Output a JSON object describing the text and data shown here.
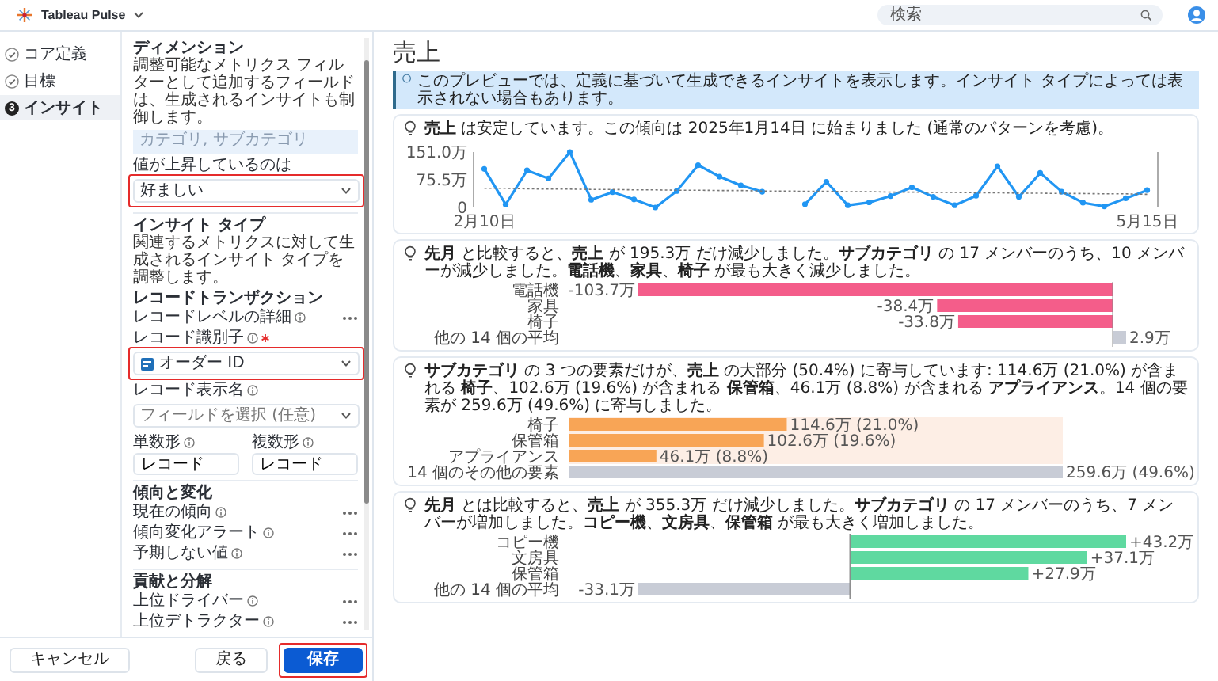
{
  "app": {
    "name": "Tableau Pulse"
  },
  "search": {
    "placeholder": "検索"
  },
  "steps": [
    {
      "label": "コア定義",
      "completed": true,
      "selected": false
    },
    {
      "label": "目標",
      "completed": true,
      "selected": false
    },
    {
      "label": "インサイト",
      "completed": false,
      "number": "3",
      "selected": true
    }
  ],
  "panel": {
    "dimension": {
      "title": "ディメンション",
      "description": "調整可能なメトリクス フィルターとして追加するフィールドは、生成されるインサイトも制御します。",
      "placeholder": "カテゴリ, サブカテゴリ"
    },
    "direction": {
      "label": "値が上昇しているのは",
      "value": "好ましい",
      "highlighted": true
    },
    "insight_types": {
      "title": "インサイト タイプ",
      "description": "関連するメトリクスに対して生成されるインサイト タイプを調整します。"
    },
    "sections": [
      {
        "title": "レコードトランザクション",
        "items": [
          {
            "kind": "option",
            "label": "レコードレベルの詳細"
          },
          {
            "kind": "select",
            "label": "レコード識別子",
            "required": true,
            "value": "オーダー ID",
            "field_icon": true,
            "highlighted": true
          },
          {
            "kind": "select",
            "label": "レコード表示名",
            "required": false,
            "placeholder": "フィールドを選択 (任意)",
            "field_icon": false,
            "highlighted": false
          },
          {
            "kind": "pair",
            "fields": [
              {
                "label": "単数形",
                "value": "レコード"
              },
              {
                "label": "複数形",
                "value": "レコード"
              }
            ]
          }
        ]
      },
      {
        "title": "傾向と変化",
        "items": [
          {
            "kind": "option",
            "label": "現在の傾向"
          },
          {
            "kind": "option",
            "label": "傾向変化アラート"
          },
          {
            "kind": "option",
            "label": "予期しない値"
          }
        ]
      },
      {
        "title": "貢献と分解",
        "items": [
          {
            "kind": "option",
            "label": "上位ドライバー"
          },
          {
            "kind": "option",
            "label": "上位デトラクター"
          }
        ]
      }
    ]
  },
  "footer": {
    "buttons": [
      {
        "label": "キャンセル",
        "kind": "cancel",
        "highlighted": false
      },
      {
        "label": "戻る",
        "kind": "back",
        "highlighted": false
      },
      {
        "label": "保存",
        "kind": "save",
        "highlighted": true
      }
    ]
  },
  "main": {
    "title": "売上",
    "banner": "このプレビューでは、定義に基づいて生成できるインサイトを表示します。インサイト タイプによっては表示されない場合もあります。",
    "cards": [
      {
        "text": "**売上** は安定しています。この傾向は 2025年1月14日 に始まりました (通常のパターンを考慮)。",
        "chart_data": {
          "type": "line",
          "categories": [
            "2月10日",
            null,
            null,
            null,
            null,
            null,
            null,
            null,
            null,
            null,
            null,
            null,
            null,
            null,
            null,
            null,
            null,
            null,
            null,
            null,
            null,
            null,
            null,
            null,
            null,
            null,
            null,
            null,
            null,
            null,
            null,
            "5月15日"
          ],
          "series": [
            {
              "color": "#2196f3",
              "line_style": "solid",
              "marker": "circle",
              "values": [
                105,
                8,
                101,
                79,
                151,
                21,
                42,
                22,
                0,
                45,
                115,
                84,
                60,
                43,
                null,
                9,
                70,
                6,
                14,
                31,
                55,
                29,
                6,
                32,
                112,
                29,
                94,
                43,
                13,
                3,
                25,
                47
              ]
            },
            {
              "color": "#777777",
              "line_style": "dashed",
              "marker": "none",
              "values": [
                52,
                52,
                51,
                50,
                50,
                49,
                49,
                48,
                48,
                47,
                47,
                46,
                46,
                45,
                45,
                44,
                44,
                43,
                43,
                42,
                42,
                41,
                41,
                40,
                40,
                39,
                39,
                38,
                38,
                37,
                37,
                36
              ]
            }
          ],
          "ylim": [
            0,
            151.0
          ],
          "yticks": [
            {
              "value": 0,
              "label": "0"
            },
            {
              "value": 75.5,
              "label": "75.5万"
            },
            {
              "value": 151.0,
              "label": "151.0万"
            }
          ]
        }
      },
      {
        "text": "**先月** と比較すると、**売上** が 195.3万 だけ減少しました。**サブカテゴリ** の 17 メンバーのうち、10 メンバーが減少しました。**電話機**、**家具**、**椅子** が最も大きく減少しました。",
        "chart_data": {
          "type": "bar",
          "orientation": "horizontal",
          "stacked": true,
          "categories": [
            "電話機",
            "家具",
            "椅子",
            "他の 14 個の平均"
          ],
          "series": [
            {
              "color": "#f45d8a",
              "values": [
                -103.7,
                -38.4,
                -33.8,
                null
              ],
              "value_labels": [
                "-103.7万",
                "-38.4万",
                "-33.8万",
                null
              ]
            },
            {
              "color": "#c8ccd6",
              "values": [
                null,
                null,
                null,
                2.9
              ],
              "value_labels": [
                null,
                null,
                null,
                "2.9万"
              ]
            }
          ]
        }
      },
      {
        "text": "**サブカテゴリ** の 3 つの要素だけが、**売上** の大部分 (50.4%) に寄与しています: 114.6万 (21.0%) が含まれる **椅子**、102.6万 (19.6%) が含まれる **保管箱**、46.1万 (8.8%) が含まれる **アプライアンス**。14 個の要素が 259.6万 (49.6%) に寄与しました。",
        "chart_data": {
          "type": "bar",
          "orientation": "horizontal",
          "stacked": true,
          "categories": [
            "椅子",
            "保管箱",
            "アプライアンス",
            "14 個のその他の要素"
          ],
          "series": [
            {
              "color": "#f8a556",
              "values": [
                114.6,
                102.6,
                46.1,
                null
              ],
              "value_labels": [
                "114.6万 (21.0%)",
                "102.6万 (19.6%)",
                "46.1万 (8.8%)",
                null
              ]
            },
            {
              "color": "#c8ccd6",
              "values": [
                null,
                null,
                null,
                259.6
              ],
              "value_labels": [
                null,
                null,
                null,
                "259.6万 (49.6%)"
              ]
            }
          ]
        }
      },
      {
        "text": "**先月** とは比較すると、**売上** が 355.3万 だけ減少しました。**サブカテゴリ** の 17 メンバーのうち、7 メンバーが増加しました。**コピー機**、**文房具**、**保管箱** が最も大きく増加しました。",
        "chart_data": {
          "type": "bar",
          "orientation": "horizontal",
          "stacked": true,
          "categories": [
            "コピー機",
            "文房具",
            "保管箱",
            "他の 14 個の平均"
          ],
          "series": [
            {
              "color": "#5fd9a0",
              "values": [
                43.2,
                37.1,
                27.9,
                null
              ],
              "value_labels": [
                "+43.2万",
                "+37.1万",
                "+27.9万",
                null
              ]
            },
            {
              "color": "#c8ccd6",
              "values": [
                null,
                null,
                null,
                -33.1
              ],
              "value_labels": [
                null,
                null,
                null,
                "-33.1万"
              ]
            }
          ]
        }
      }
    ]
  }
}
